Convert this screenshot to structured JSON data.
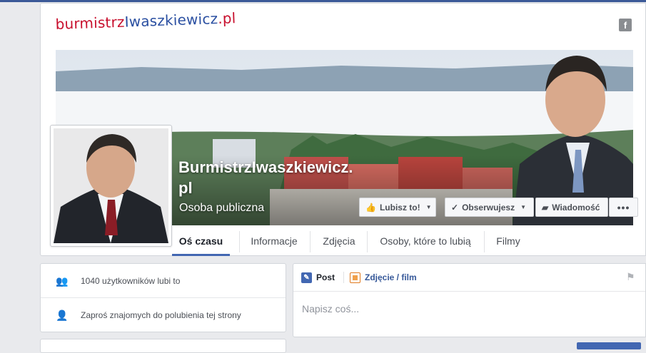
{
  "logo": {
    "part1": "burmistrz",
    "part2": "Iwaszkiewicz",
    "part3": ".pl"
  },
  "header_icon": "facebook-icon",
  "page": {
    "title": "BurmistrzIwaszkiewicz.pl",
    "category": "Osoba publiczna"
  },
  "actions": {
    "like": "Lubisz to!",
    "follow": "Obserwujesz",
    "message": "Wiadomość",
    "more": "•••"
  },
  "tabs": [
    {
      "label": "Oś czasu",
      "active": true
    },
    {
      "label": "Informacje",
      "active": false
    },
    {
      "label": "Zdjęcia",
      "active": false
    },
    {
      "label": "Osoby, które to lubią",
      "active": false
    },
    {
      "label": "Filmy",
      "active": false
    }
  ],
  "sidebar": {
    "likes": "1040 użytkowników lubi to",
    "invite": "Zaproś znajomych do polubienia tej strony"
  },
  "composer": {
    "tab_post": "Post",
    "tab_photo": "Zdjęcie / film",
    "placeholder": "Napisz coś..."
  },
  "colors": {
    "accent": "#4267b2",
    "brand_red": "#c8102e",
    "brand_blue": "#2a4fa1"
  }
}
